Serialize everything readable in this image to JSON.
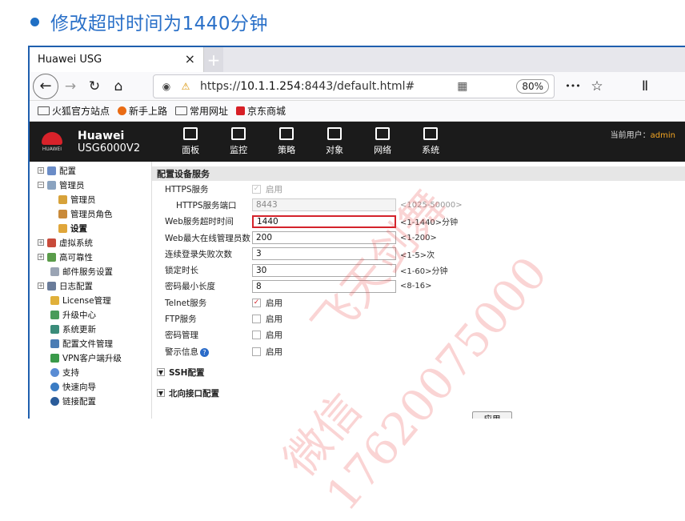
{
  "slide": {
    "title": "修改超时时间为1440分钟"
  },
  "browser": {
    "tab_title": "Huawei USG",
    "close_glyph": "×",
    "new_tab_glyph": "+",
    "url_prefix": "https://",
    "url_host": "10.1.1.254",
    "url_rest": ":8443/default.html#",
    "zoom": "80%",
    "more_glyph": "•••",
    "bookmarks": [
      "火狐官方站点",
      "新手上路",
      "常用网址",
      "京东商城"
    ]
  },
  "app": {
    "brand_line1": "Huawei",
    "brand_line2": "USG6000V2",
    "logo_text": "HUAWEI",
    "nav": [
      "面板",
      "监控",
      "策略",
      "对象",
      "网络",
      "系统"
    ],
    "user_label": "当前用户：",
    "user_name": "admin"
  },
  "sidebar": {
    "items": [
      {
        "label": "配置",
        "toggle": "+"
      },
      {
        "label": "管理员",
        "toggle": "−"
      },
      {
        "label": "管理员"
      },
      {
        "label": "管理员角色"
      },
      {
        "label": "设置"
      },
      {
        "label": "虚拟系统",
        "toggle": "+"
      },
      {
        "label": "高可靠性",
        "toggle": "+"
      },
      {
        "label": "邮件服务设置"
      },
      {
        "label": "日志配置",
        "toggle": "+"
      },
      {
        "label": "License管理"
      },
      {
        "label": "升级中心"
      },
      {
        "label": "系统更新"
      },
      {
        "label": "配置文件管理"
      },
      {
        "label": "VPN客户端升级"
      },
      {
        "label": "支持"
      },
      {
        "label": "快速向导"
      },
      {
        "label": "链接配置"
      }
    ]
  },
  "form": {
    "section_title": "配置设备服务",
    "https_label": "HTTPS服务",
    "https_checkbox_label": "启用",
    "https_port_label": "HTTPS服务端口",
    "https_port_value": "8443",
    "https_port_hint": "<1025-50000>",
    "web_timeout_label": "Web服务超时时间",
    "web_timeout_value": "1440",
    "web_timeout_hint": "<1-1440>分钟",
    "web_max_label": "Web最大在线管理员数",
    "web_max_value": "200",
    "web_max_hint": "<1-200>",
    "login_fail_label": "连续登录失败次数",
    "login_fail_value": "3",
    "login_fail_hint": "<1-5>次",
    "lock_label": "锁定时长",
    "lock_value": "30",
    "lock_hint": "<1-60>分钟",
    "pwdlen_label": "密码最小长度",
    "pwdlen_value": "8",
    "pwdlen_hint": "<8-16>",
    "telnet_label": "Telnet服务",
    "telnet_cb_label": "启用",
    "ftp_label": "FTP服务",
    "ftp_cb_label": "启用",
    "pwdmgmt_label": "密码管理",
    "pwdmgmt_cb_label": "启用",
    "warn_label": "警示信息",
    "warn_cb_label": "启用",
    "help_glyph": "?",
    "check_glyph": "✓",
    "collapse_glyph": "▼",
    "ssh_section": "SSH配置",
    "north_section": "北向接口配置",
    "apply_label": "应用"
  },
  "watermark": {
    "line1": "飞天剑舞",
    "line2": "微信17620075000"
  }
}
